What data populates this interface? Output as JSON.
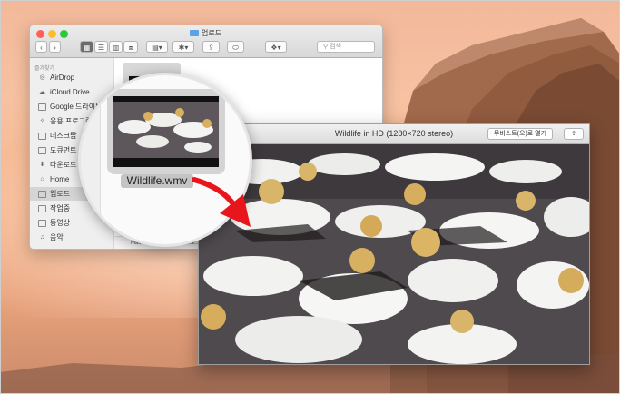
{
  "finder": {
    "window_title": "업로드",
    "view_modes": [
      "icon-view",
      "list-view",
      "column-view",
      "cover-flow-view"
    ],
    "arrange_icon": "arrange-icon",
    "action_icon": "gear-icon",
    "share_icon": "share-icon",
    "tag_icon": "tag-icon",
    "dropbox_icon": "dropbox-icon",
    "search_placeholder": "검색",
    "sidebar": {
      "heading": "즐겨찾기",
      "items": [
        {
          "label": "AirDrop",
          "icon": "airdrop-icon"
        },
        {
          "label": "iCloud Drive",
          "icon": "cloud-icon"
        },
        {
          "label": "Google 드라이브",
          "icon": "folder-icon"
        },
        {
          "label": "응용 프로그램",
          "icon": "applications-icon"
        },
        {
          "label": "데스크탑",
          "icon": "desktop-icon"
        },
        {
          "label": "도큐먼트",
          "icon": "documents-icon"
        },
        {
          "label": "다운로드",
          "icon": "downloads-icon"
        },
        {
          "label": "Home",
          "icon": "home-icon"
        },
        {
          "label": "업로드",
          "icon": "folder-icon",
          "selected": true
        },
        {
          "label": "작업중",
          "icon": "folder-icon"
        },
        {
          "label": "동영상",
          "icon": "movies-icon"
        },
        {
          "label": "음악",
          "icon": "music-icon"
        }
      ]
    },
    "status_path": "Mac HD ▸ Mavericks ▸ Ma...Session ▸",
    "file": {
      "name": "Wildlife.wmv"
    }
  },
  "video_window": {
    "title": "Wildlife in HD (1280×720 stereo)",
    "open_with_label": "무비스트(으)로 열기",
    "share_icon": "share-icon"
  },
  "magnifier": {
    "file_label": "Wildlife.wmv"
  },
  "colors": {
    "arrow": "#e8161c",
    "desktop_sky": "#f6b790",
    "finder_selection": "#d5d5d5",
    "folder_accent": "#5ba3e6"
  }
}
